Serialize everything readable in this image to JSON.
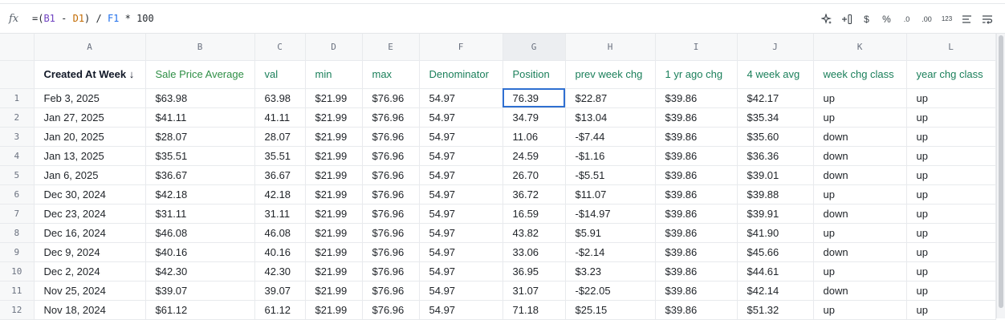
{
  "formula_bar": {
    "fx_label": "fx",
    "formula_prefix": "=(",
    "ref1": "B1",
    "op1": " - ",
    "ref2": "D1",
    "op2": ") / ",
    "ref3": "F1",
    "op3": " * 100"
  },
  "toolbar": {
    "tools": [
      "ai-sparkle-icon",
      "add-column-icon",
      "currency-icon",
      "percent-icon",
      "decrease-decimal-icon",
      "increase-decimal-icon",
      "number-format-icon",
      "align-icon",
      "wrap-text-icon"
    ],
    "labels": {
      "currency": "$",
      "percent": "%",
      "dec_decimal": ".0",
      "inc_decimal": ".00",
      "num_format": "123"
    }
  },
  "columns": [
    "A",
    "B",
    "C",
    "D",
    "E",
    "F",
    "G",
    "H",
    "I",
    "J",
    "K",
    "L"
  ],
  "selected_column": "G",
  "headers": [
    "Created At Week ↓",
    "Sale Price Average",
    "val",
    "min",
    "max",
    "Denominator",
    "Position",
    "prev week chg",
    "1 yr ago chg",
    "4 week avg",
    "week chg class",
    "year chg class"
  ],
  "rows": [
    [
      "1",
      "Feb 3, 2025",
      "$63.98",
      "63.98",
      "$21.99",
      "$76.96",
      "54.97",
      "76.39",
      "$22.87",
      "$39.86",
      "$42.17",
      "up",
      "up"
    ],
    [
      "2",
      "Jan 27, 2025",
      "$41.11",
      "41.11",
      "$21.99",
      "$76.96",
      "54.97",
      "34.79",
      "$13.04",
      "$39.86",
      "$35.34",
      "up",
      "up"
    ],
    [
      "3",
      "Jan 20, 2025",
      "$28.07",
      "28.07",
      "$21.99",
      "$76.96",
      "54.97",
      "11.06",
      "-$7.44",
      "$39.86",
      "$35.60",
      "down",
      "up"
    ],
    [
      "4",
      "Jan 13, 2025",
      "$35.51",
      "35.51",
      "$21.99",
      "$76.96",
      "54.97",
      "24.59",
      "-$1.16",
      "$39.86",
      "$36.36",
      "down",
      "up"
    ],
    [
      "5",
      "Jan 6, 2025",
      "$36.67",
      "36.67",
      "$21.99",
      "$76.96",
      "54.97",
      "26.70",
      "-$5.51",
      "$39.86",
      "$39.01",
      "down",
      "up"
    ],
    [
      "6",
      "Dec 30, 2024",
      "$42.18",
      "42.18",
      "$21.99",
      "$76.96",
      "54.97",
      "36.72",
      "$11.07",
      "$39.86",
      "$39.88",
      "up",
      "up"
    ],
    [
      "7",
      "Dec 23, 2024",
      "$31.11",
      "31.11",
      "$21.99",
      "$76.96",
      "54.97",
      "16.59",
      "-$14.97",
      "$39.86",
      "$39.91",
      "down",
      "up"
    ],
    [
      "8",
      "Dec 16, 2024",
      "$46.08",
      "46.08",
      "$21.99",
      "$76.96",
      "54.97",
      "43.82",
      "$5.91",
      "$39.86",
      "$41.90",
      "up",
      "up"
    ],
    [
      "9",
      "Dec 9, 2024",
      "$40.16",
      "40.16",
      "$21.99",
      "$76.96",
      "54.97",
      "33.06",
      "-$2.14",
      "$39.86",
      "$45.66",
      "down",
      "up"
    ],
    [
      "10",
      "Dec 2, 2024",
      "$42.30",
      "42.30",
      "$21.99",
      "$76.96",
      "54.97",
      "36.95",
      "$3.23",
      "$39.86",
      "$44.61",
      "up",
      "up"
    ],
    [
      "11",
      "Nov 25, 2024",
      "$39.07",
      "39.07",
      "$21.99",
      "$76.96",
      "54.97",
      "31.07",
      "-$22.05",
      "$39.86",
      "$42.14",
      "down",
      "up"
    ],
    [
      "12",
      "Nov 18, 2024",
      "$61.12",
      "61.12",
      "$21.99",
      "$76.96",
      "54.97",
      "71.18",
      "$25.15",
      "$39.86",
      "$51.32",
      "up",
      "up"
    ]
  ],
  "active_cell": {
    "row": 1,
    "col": "G"
  }
}
